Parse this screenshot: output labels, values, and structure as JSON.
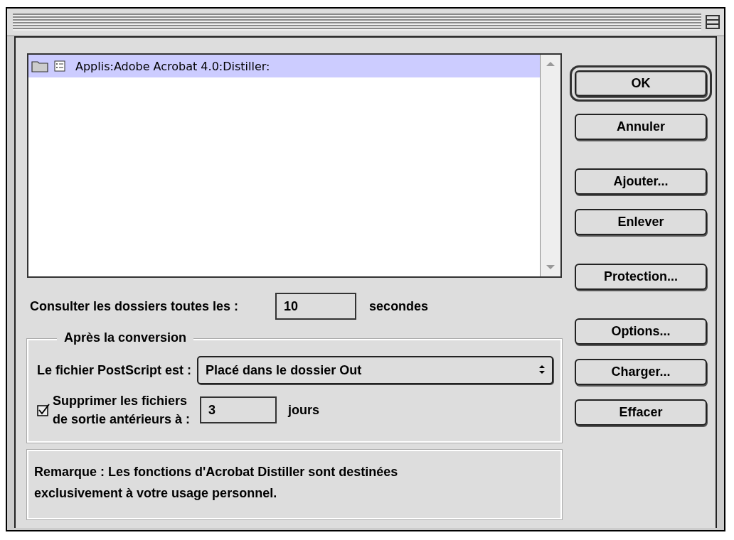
{
  "folder_list": {
    "items": [
      {
        "path": "Applis:Adobe Acrobat 4.0:Distiller:",
        "selected": true
      }
    ]
  },
  "poll": {
    "label": "Consulter les dossiers toutes les :",
    "value": "10",
    "unit": "secondes"
  },
  "after_conversion": {
    "legend": "Après la conversion",
    "postscript_label": "Le fichier PostScript est :",
    "postscript_value": "Placé dans le dossier Out",
    "delete_checked": true,
    "delete_label_lines": [
      "Supprimer les fichiers",
      "de sortie antérieurs à :"
    ],
    "days_value": "3",
    "days_unit": "jours"
  },
  "remark": "Remarque : Les fonctions d'Acrobat Distiller sont destinées exclusivement à votre usage personnel.",
  "button_groups": [
    [
      {
        "label": "OK",
        "default": true
      },
      {
        "label": "Annuler",
        "default": false
      }
    ],
    [
      {
        "label": "Ajouter...",
        "default": false
      },
      {
        "label": "Enlever",
        "default": false
      }
    ],
    [
      {
        "label": "Protection...",
        "default": false
      }
    ],
    [
      {
        "label": "Options...",
        "default": false
      },
      {
        "label": "Charger...",
        "default": false
      },
      {
        "label": "Effacer",
        "default": false
      }
    ]
  ]
}
